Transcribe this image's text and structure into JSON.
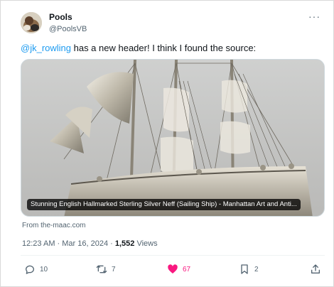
{
  "author": {
    "display_name": "Pools",
    "handle": "@PoolsVB"
  },
  "tweet": {
    "mention": "@jk_rowling",
    "text": " has a new header! I think I found the source:"
  },
  "card": {
    "caption": "Stunning English Hallmarked Sterling Silver Neff (Sailing Ship) - Manhattan Art and Anti...",
    "source": "From the-maac.com"
  },
  "meta": {
    "timestamp": "12:23 AM · Mar 16, 2024 · ",
    "views_count": "1,552",
    "views_label": " Views"
  },
  "actions": {
    "replies": "10",
    "reposts": "7",
    "likes": "67",
    "bookmarks": "2"
  },
  "colors": {
    "link": "#1d9bf0",
    "like": "#f91880",
    "secondary_text": "#536471"
  },
  "icons": {
    "more": "more-horizontal-icon",
    "reply": "reply-icon",
    "repost": "repost-icon",
    "like": "heart-icon",
    "bookmark": "bookmark-icon",
    "share": "share-icon"
  }
}
